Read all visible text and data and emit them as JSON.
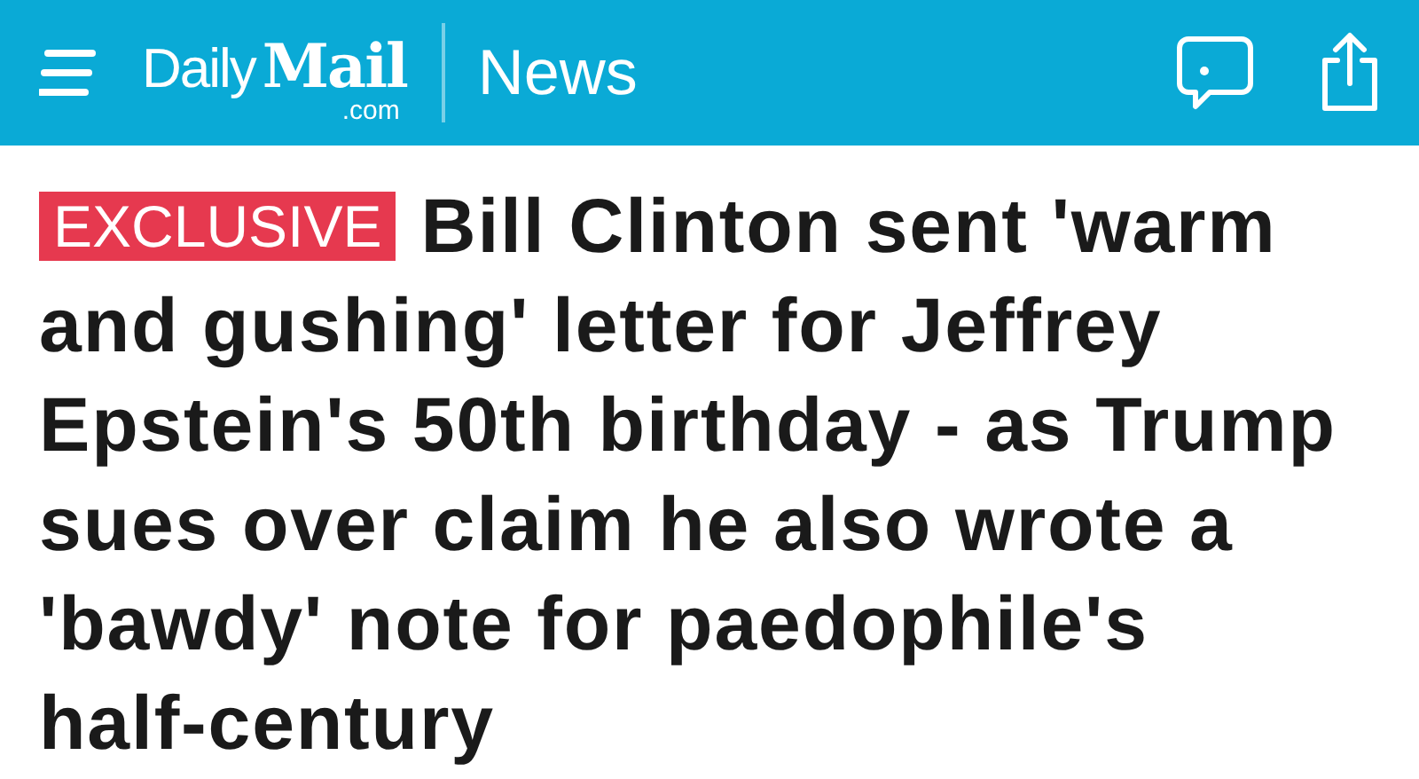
{
  "header": {
    "logo": {
      "daily": "Daily",
      "mail": "Mail",
      "domain": ".com"
    },
    "section": "News"
  },
  "article": {
    "badge": "EXCLUSIVE",
    "headline": "Bill Clinton sent 'warm and gushing' letter for Jeffrey Epstein's 50th birthday - as Trump sues over claim he also wrote a 'bawdy' note for paedophile's half-century"
  }
}
